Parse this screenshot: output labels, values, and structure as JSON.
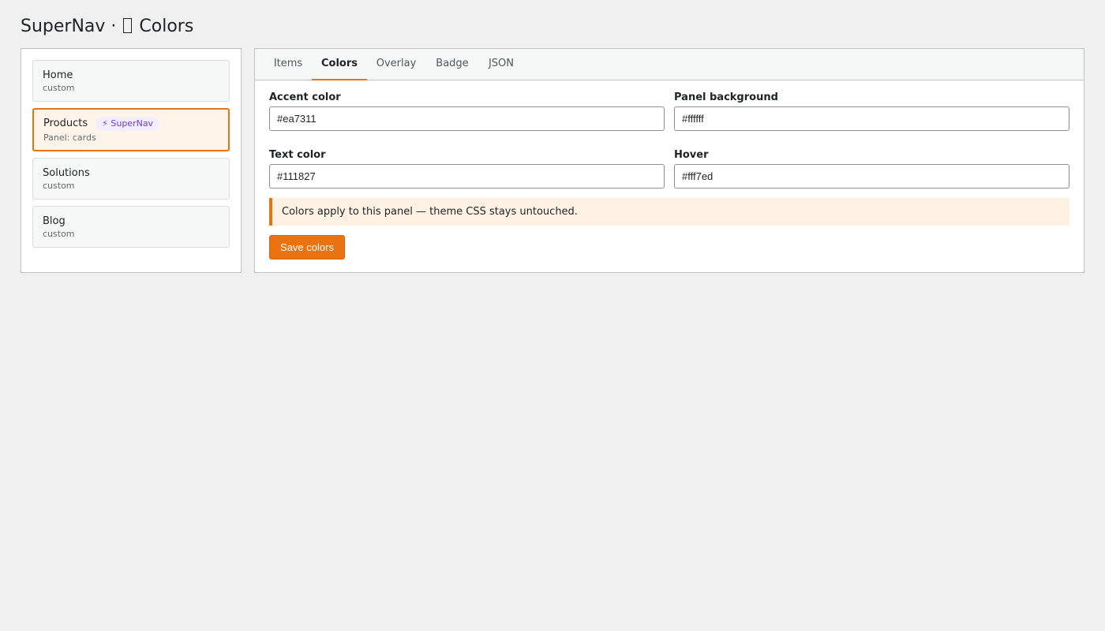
{
  "header": {
    "title": "SuperNav · ",
    "title_icon": "box-icon",
    "title_suffix": " Colors"
  },
  "menu_items": [
    {
      "name": "Home",
      "sub": "custom",
      "selected": false
    },
    {
      "name": "Products",
      "sub": "Panel: cards",
      "badge": "⚡ SuperNav",
      "selected": true
    },
    {
      "name": "Solutions",
      "sub": "custom",
      "selected": false
    },
    {
      "name": "Blog",
      "sub": "custom",
      "selected": false
    }
  ],
  "tabs": [
    {
      "label": "Items",
      "active": false
    },
    {
      "label": "Colors",
      "active": true
    },
    {
      "label": "Overlay",
      "active": false
    },
    {
      "label": "Badge",
      "active": false
    },
    {
      "label": "JSON",
      "active": false
    }
  ],
  "fields": {
    "accent": {
      "label": "Accent color",
      "value": "#ea7311"
    },
    "panel_bg": {
      "label": "Panel background",
      "value": "#ffffff"
    },
    "text_color": {
      "label": "Text color",
      "value": "#111827"
    },
    "hover": {
      "label": "Hover",
      "value": "#fff7ed"
    }
  },
  "notice": "Colors apply to this panel — theme CSS stays untouched.",
  "save_label": "Save colors",
  "colors": {
    "accent": "#ea7311",
    "badge_text": "#6d3ae3",
    "badge_bg": "#f3eefe",
    "selected_bg": "#fff4e9",
    "notice_bg": "#fff2e4"
  }
}
